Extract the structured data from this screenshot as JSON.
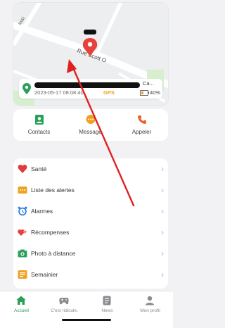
{
  "map": {
    "street_labels": [
      "Rue Scott O",
      "Rue Scott O",
      "sssi"
    ],
    "marker_color": "#e8403a"
  },
  "location": {
    "address_tail": "Ca...",
    "timestamp": "2023-05-17 08:08:40",
    "source": "GPS",
    "battery": "40%",
    "battery_level": 0.4
  },
  "quick_actions": [
    {
      "label": "Contacts",
      "icon": "contacts-icon"
    },
    {
      "label": "Message",
      "icon": "message-icon"
    },
    {
      "label": "Appeler",
      "icon": "phone-icon"
    }
  ],
  "menu": [
    {
      "label": "Santé",
      "icon": "heart-icon"
    },
    {
      "label": "Liste des alertes",
      "icon": "alert-list-icon"
    },
    {
      "label": "Alarmes",
      "icon": "alarm-clock-icon"
    },
    {
      "label": "Récompenses",
      "icon": "rewards-icon"
    },
    {
      "label": "Photo à distance",
      "icon": "camera-icon"
    },
    {
      "label": "Semainier",
      "icon": "planner-icon"
    }
  ],
  "tabs": [
    {
      "label": "Accueil",
      "icon": "home-icon",
      "active": true
    },
    {
      "label": "C'est ridicule.",
      "icon": "gamepad-icon",
      "active": false
    },
    {
      "label": "News",
      "icon": "news-icon",
      "active": false
    },
    {
      "label": "Mon profil",
      "icon": "profile-icon",
      "active": false
    }
  ],
  "colors": {
    "accent_green": "#2aa05a",
    "arrow_red": "#e02020",
    "gps_orange": "#f0a020"
  }
}
